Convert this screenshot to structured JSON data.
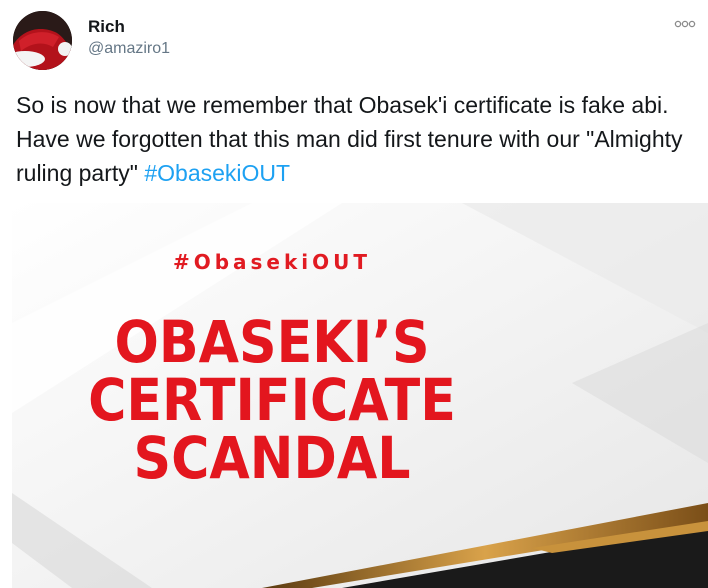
{
  "user": {
    "display_name": "Rich",
    "handle": "@amaziro1",
    "avatar_icon": "santa-hat-avatar"
  },
  "menu": {
    "icon": "more-options-icon"
  },
  "tweet": {
    "text": "So is now that we remember that Obasek'i certificate is fake abi. Have we forgotten that this man did first tenure with our \"Almighty ruling party\" ",
    "hashtag": "#ObasekiOUT"
  },
  "media": {
    "hashtag": "#ObasekiOUT",
    "headline_lines": [
      "OBASEKI’S",
      "CERTIFICATE",
      "SCANDAL"
    ]
  },
  "colors": {
    "hashtag_link": "#1da1f2",
    "headline_red": "#e3161e",
    "text": "#14171a",
    "handle_gray": "#657786"
  }
}
